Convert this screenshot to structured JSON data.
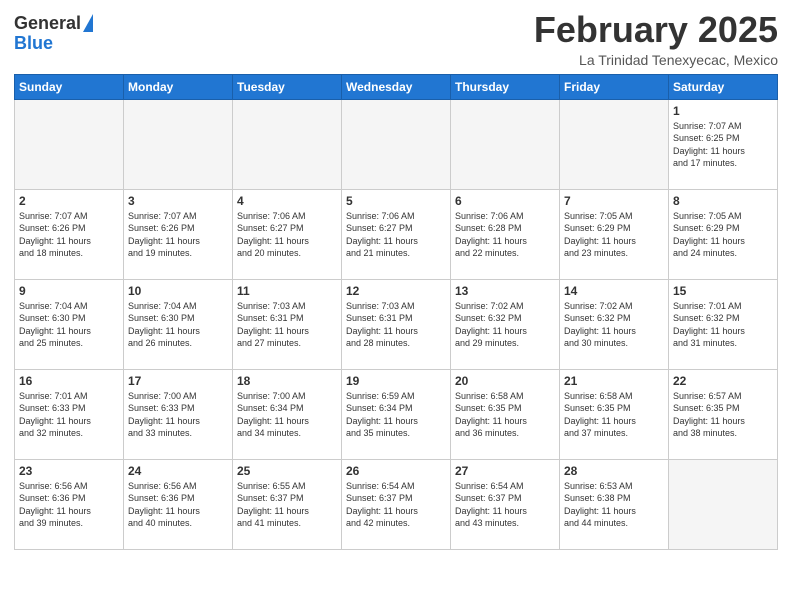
{
  "header": {
    "logo_general": "General",
    "logo_blue": "Blue",
    "title": "February 2025",
    "location": "La Trinidad Tenexyecac, Mexico"
  },
  "weekdays": [
    "Sunday",
    "Monday",
    "Tuesday",
    "Wednesday",
    "Thursday",
    "Friday",
    "Saturday"
  ],
  "weeks": [
    [
      {
        "day": "",
        "info": ""
      },
      {
        "day": "",
        "info": ""
      },
      {
        "day": "",
        "info": ""
      },
      {
        "day": "",
        "info": ""
      },
      {
        "day": "",
        "info": ""
      },
      {
        "day": "",
        "info": ""
      },
      {
        "day": "1",
        "info": "Sunrise: 7:07 AM\nSunset: 6:25 PM\nDaylight: 11 hours\nand 17 minutes."
      }
    ],
    [
      {
        "day": "2",
        "info": "Sunrise: 7:07 AM\nSunset: 6:26 PM\nDaylight: 11 hours\nand 18 minutes."
      },
      {
        "day": "3",
        "info": "Sunrise: 7:07 AM\nSunset: 6:26 PM\nDaylight: 11 hours\nand 19 minutes."
      },
      {
        "day": "4",
        "info": "Sunrise: 7:06 AM\nSunset: 6:27 PM\nDaylight: 11 hours\nand 20 minutes."
      },
      {
        "day": "5",
        "info": "Sunrise: 7:06 AM\nSunset: 6:27 PM\nDaylight: 11 hours\nand 21 minutes."
      },
      {
        "day": "6",
        "info": "Sunrise: 7:06 AM\nSunset: 6:28 PM\nDaylight: 11 hours\nand 22 minutes."
      },
      {
        "day": "7",
        "info": "Sunrise: 7:05 AM\nSunset: 6:29 PM\nDaylight: 11 hours\nand 23 minutes."
      },
      {
        "day": "8",
        "info": "Sunrise: 7:05 AM\nSunset: 6:29 PM\nDaylight: 11 hours\nand 24 minutes."
      }
    ],
    [
      {
        "day": "9",
        "info": "Sunrise: 7:04 AM\nSunset: 6:30 PM\nDaylight: 11 hours\nand 25 minutes."
      },
      {
        "day": "10",
        "info": "Sunrise: 7:04 AM\nSunset: 6:30 PM\nDaylight: 11 hours\nand 26 minutes."
      },
      {
        "day": "11",
        "info": "Sunrise: 7:03 AM\nSunset: 6:31 PM\nDaylight: 11 hours\nand 27 minutes."
      },
      {
        "day": "12",
        "info": "Sunrise: 7:03 AM\nSunset: 6:31 PM\nDaylight: 11 hours\nand 28 minutes."
      },
      {
        "day": "13",
        "info": "Sunrise: 7:02 AM\nSunset: 6:32 PM\nDaylight: 11 hours\nand 29 minutes."
      },
      {
        "day": "14",
        "info": "Sunrise: 7:02 AM\nSunset: 6:32 PM\nDaylight: 11 hours\nand 30 minutes."
      },
      {
        "day": "15",
        "info": "Sunrise: 7:01 AM\nSunset: 6:32 PM\nDaylight: 11 hours\nand 31 minutes."
      }
    ],
    [
      {
        "day": "16",
        "info": "Sunrise: 7:01 AM\nSunset: 6:33 PM\nDaylight: 11 hours\nand 32 minutes."
      },
      {
        "day": "17",
        "info": "Sunrise: 7:00 AM\nSunset: 6:33 PM\nDaylight: 11 hours\nand 33 minutes."
      },
      {
        "day": "18",
        "info": "Sunrise: 7:00 AM\nSunset: 6:34 PM\nDaylight: 11 hours\nand 34 minutes."
      },
      {
        "day": "19",
        "info": "Sunrise: 6:59 AM\nSunset: 6:34 PM\nDaylight: 11 hours\nand 35 minutes."
      },
      {
        "day": "20",
        "info": "Sunrise: 6:58 AM\nSunset: 6:35 PM\nDaylight: 11 hours\nand 36 minutes."
      },
      {
        "day": "21",
        "info": "Sunrise: 6:58 AM\nSunset: 6:35 PM\nDaylight: 11 hours\nand 37 minutes."
      },
      {
        "day": "22",
        "info": "Sunrise: 6:57 AM\nSunset: 6:35 PM\nDaylight: 11 hours\nand 38 minutes."
      }
    ],
    [
      {
        "day": "23",
        "info": "Sunrise: 6:56 AM\nSunset: 6:36 PM\nDaylight: 11 hours\nand 39 minutes."
      },
      {
        "day": "24",
        "info": "Sunrise: 6:56 AM\nSunset: 6:36 PM\nDaylight: 11 hours\nand 40 minutes."
      },
      {
        "day": "25",
        "info": "Sunrise: 6:55 AM\nSunset: 6:37 PM\nDaylight: 11 hours\nand 41 minutes."
      },
      {
        "day": "26",
        "info": "Sunrise: 6:54 AM\nSunset: 6:37 PM\nDaylight: 11 hours\nand 42 minutes."
      },
      {
        "day": "27",
        "info": "Sunrise: 6:54 AM\nSunset: 6:37 PM\nDaylight: 11 hours\nand 43 minutes."
      },
      {
        "day": "28",
        "info": "Sunrise: 6:53 AM\nSunset: 6:38 PM\nDaylight: 11 hours\nand 44 minutes."
      },
      {
        "day": "",
        "info": ""
      }
    ]
  ]
}
